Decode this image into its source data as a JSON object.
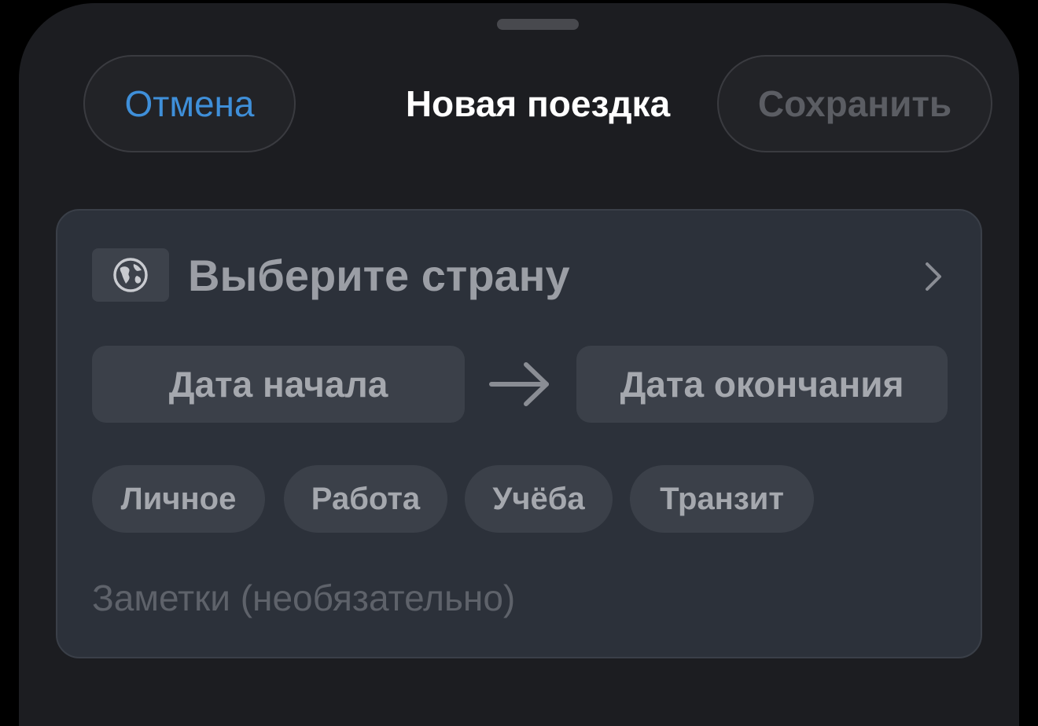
{
  "header": {
    "cancel_label": "Отмена",
    "title": "Новая поездка",
    "save_label": "Сохранить"
  },
  "form": {
    "country_placeholder": "Выберите страну",
    "start_date_label": "Дата начала",
    "end_date_label": "Дата окончания",
    "categories": [
      "Личное",
      "Работа",
      "Учёба",
      "Транзит"
    ],
    "notes_placeholder": "Заметки (необязательно)"
  },
  "icons": {
    "country": "globe-icon",
    "country_action": "chevron-right-icon",
    "date_separator": "arrow-right-icon"
  },
  "colors": {
    "accent": "#3f8fd9",
    "sheet_background": "#1c1d21",
    "card_background": "#2c313a",
    "control_background": "#3b4049"
  }
}
